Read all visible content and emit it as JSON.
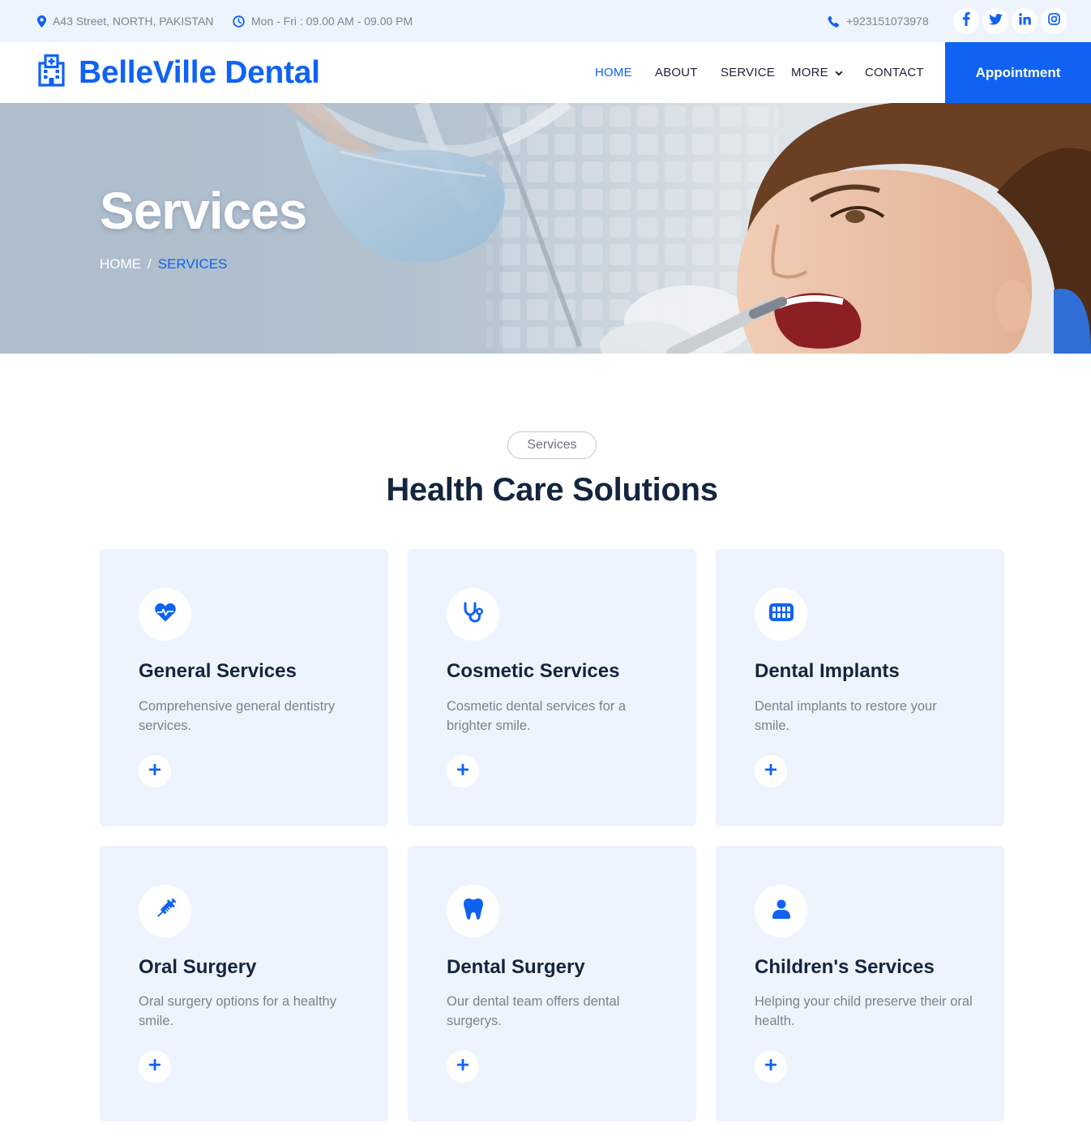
{
  "topbar": {
    "address": "A43 Street, NORTH, PAKISTAN",
    "hours": "Mon - Fri : 09.00 AM - 09.00 PM",
    "phone": "+923151073978",
    "social_icons": [
      "facebook-icon",
      "twitter-icon",
      "linkedin-icon",
      "instagram-icon"
    ]
  },
  "brand": {
    "name": "BelleVille Dental",
    "icon": "hospital-icon"
  },
  "nav": {
    "items": [
      {
        "label": "HOME",
        "active": true
      },
      {
        "label": "ABOUT"
      },
      {
        "label": "SERVICE"
      },
      {
        "label": "MORE",
        "has_dropdown": true
      },
      {
        "label": "CONTACT"
      }
    ],
    "cta": "Appointment"
  },
  "hero": {
    "title": "Services",
    "breadcrumb": {
      "home": "HOME",
      "separator": "/",
      "current": "SERVICES"
    }
  },
  "section": {
    "tag": "Services",
    "title": "Health Care Solutions"
  },
  "services": [
    {
      "icon": "heart-pulse-icon",
      "title": "General Services",
      "desc": "Comprehensive general dentistry services."
    },
    {
      "icon": "stethoscope-icon",
      "title": "Cosmetic Services",
      "desc": "Cosmetic dental services for a brighter smile."
    },
    {
      "icon": "teeth-icon",
      "title": "Dental Implants",
      "desc": "Dental implants to restore your smile."
    },
    {
      "icon": "syringe-icon",
      "title": "Oral Surgery",
      "desc": "Oral surgery options for a healthy smile."
    },
    {
      "icon": "tooth-icon",
      "title": "Dental Surgery",
      "desc": "Our dental team offers dental surgerys."
    },
    {
      "icon": "user-icon",
      "title": "Children's Services",
      "desc": "Helping your child preserve their oral health."
    }
  ],
  "colors": {
    "primary": "#0f62f2",
    "heading": "#13253f",
    "muted": "#7a8291",
    "card_bg": "#eef4fe"
  }
}
